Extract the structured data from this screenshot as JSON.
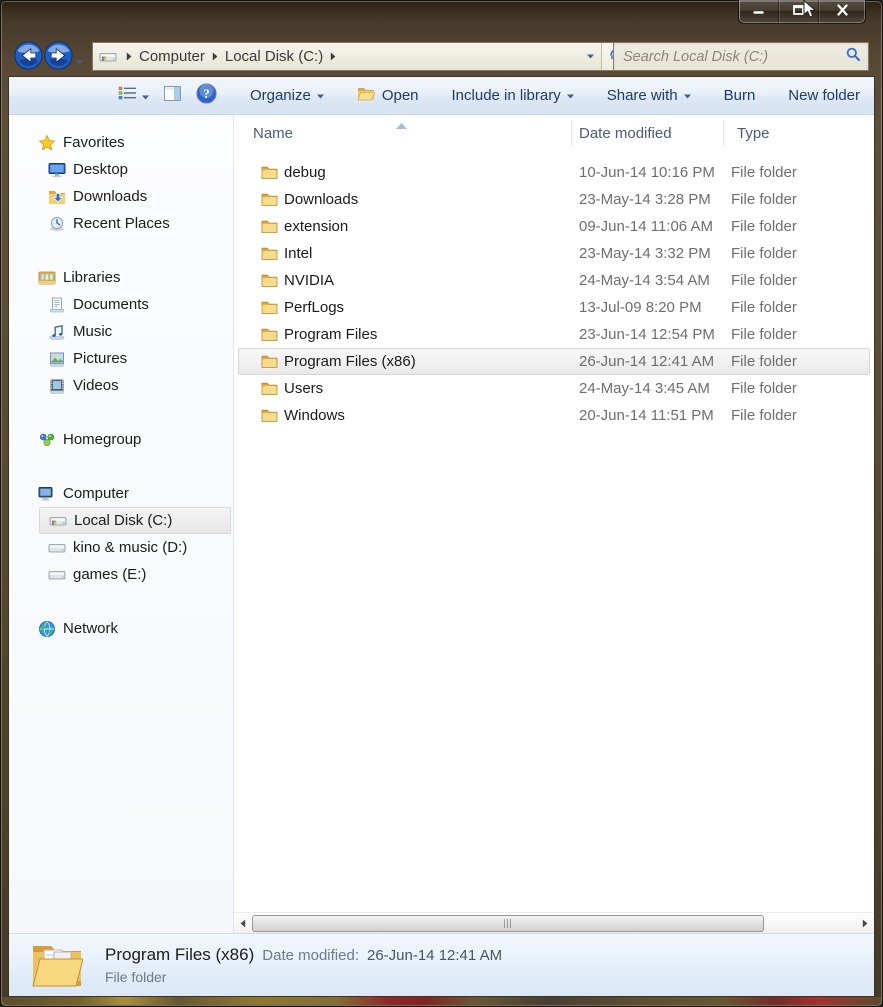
{
  "nav": {
    "breadcrumb": {
      "items": [
        "Computer",
        "Local Disk (C:)"
      ]
    },
    "search": {
      "placeholder": "Search Local Disk (C:)"
    }
  },
  "icons": {
    "back": "back-icon",
    "forward": "forward-icon",
    "history_caret": "caret-down-icon",
    "drive": "local-disk-icon",
    "crumb_arrow": "crumb-arrow-icon",
    "address_caret": "caret-down-icon",
    "refresh": "refresh-icon",
    "search": "search-icon",
    "views": "views-icon",
    "views_caret": "caret-down-icon",
    "preview": "preview-pane-icon",
    "help": "help-icon",
    "sort_asc": "sort-asc-icon",
    "row_folder": "folder-icon",
    "details_folder": "big-folder-icon",
    "minimize": "minimize-icon",
    "maximize": "maximize-icon",
    "close": "close-icon",
    "cursor": "cursor-icon",
    "scroll_left": "scroll-left-icon",
    "scroll_right": "scroll-right-icon"
  },
  "toolbar": {
    "items": [
      {
        "label": "Organize",
        "caret": true
      },
      {
        "label": "Open",
        "icon": "open-folder-icon"
      },
      {
        "label": "Include in library",
        "caret": true
      },
      {
        "label": "Share with",
        "caret": true
      },
      {
        "label": "Burn"
      },
      {
        "label": "New folder"
      }
    ]
  },
  "sidebar": {
    "items": [
      {
        "label": "Favorites",
        "icon": "favorites-star-icon",
        "level": 0
      },
      {
        "label": "Desktop",
        "icon": "desktop-icon",
        "level": 1
      },
      {
        "label": "Downloads",
        "icon": "downloads-folder-icon",
        "level": 1
      },
      {
        "label": "Recent Places",
        "icon": "recent-places-icon",
        "level": 1
      },
      {
        "label": "Libraries",
        "icon": "libraries-icon",
        "level": 0,
        "gap": true
      },
      {
        "label": "Documents",
        "icon": "documents-icon",
        "level": 1
      },
      {
        "label": "Music",
        "icon": "music-icon",
        "level": 1
      },
      {
        "label": "Pictures",
        "icon": "pictures-icon",
        "level": 1
      },
      {
        "label": "Videos",
        "icon": "videos-icon",
        "level": 1
      },
      {
        "label": "Homegroup",
        "icon": "homegroup-icon",
        "level": 0,
        "gap": true
      },
      {
        "label": "Computer",
        "icon": "computer-icon",
        "level": 0,
        "gap": true
      },
      {
        "label": "Local Disk (C:)",
        "icon": "local-disk-icon",
        "level": 1,
        "selected": true
      },
      {
        "label": "kino & music (D:)",
        "icon": "disk-drive-icon",
        "level": 1
      },
      {
        "label": "games (E:)",
        "icon": "disk-drive-icon",
        "level": 1
      },
      {
        "label": "Network",
        "icon": "network-icon",
        "level": 0,
        "gap": true
      }
    ]
  },
  "files": {
    "columns": {
      "name": "Name",
      "date": "Date modified",
      "type": "Type"
    },
    "rows": [
      {
        "name": "debug",
        "date": "10-Jun-14 10:16 PM",
        "type": "File folder"
      },
      {
        "name": "Downloads",
        "date": "23-May-14 3:28 PM",
        "type": "File folder"
      },
      {
        "name": "extension",
        "date": "09-Jun-14 11:06 AM",
        "type": "File folder"
      },
      {
        "name": "Intel",
        "date": "23-May-14 3:32 PM",
        "type": "File folder"
      },
      {
        "name": "NVIDIA",
        "date": "24-May-14 3:54 AM",
        "type": "File folder"
      },
      {
        "name": "PerfLogs",
        "date": "13-Jul-09 8:20 PM",
        "type": "File folder"
      },
      {
        "name": "Program Files",
        "date": "23-Jun-14 12:54 PM",
        "type": "File folder"
      },
      {
        "name": "Program Files (x86)",
        "date": "26-Jun-14 12:41 AM",
        "type": "File folder",
        "selected": true
      },
      {
        "name": "Users",
        "date": "24-May-14 3:45 AM",
        "type": "File folder"
      },
      {
        "name": "Windows",
        "date": "20-Jun-14 11:51 PM",
        "type": "File folder"
      }
    ]
  },
  "details": {
    "name": "Program Files (x86)",
    "date_label": "Date modified:",
    "date_value": "26-Jun-14 12:41 AM",
    "type": "File folder"
  },
  "colors": {
    "chrome_glass": "#5a4933",
    "toolbar_text": "#1e3c64",
    "toolbar_bg": "#dde7f5",
    "selection_gray": "#e9e9e9",
    "details_bg": "#dce8f6",
    "date_text": "#6e6e6e"
  }
}
